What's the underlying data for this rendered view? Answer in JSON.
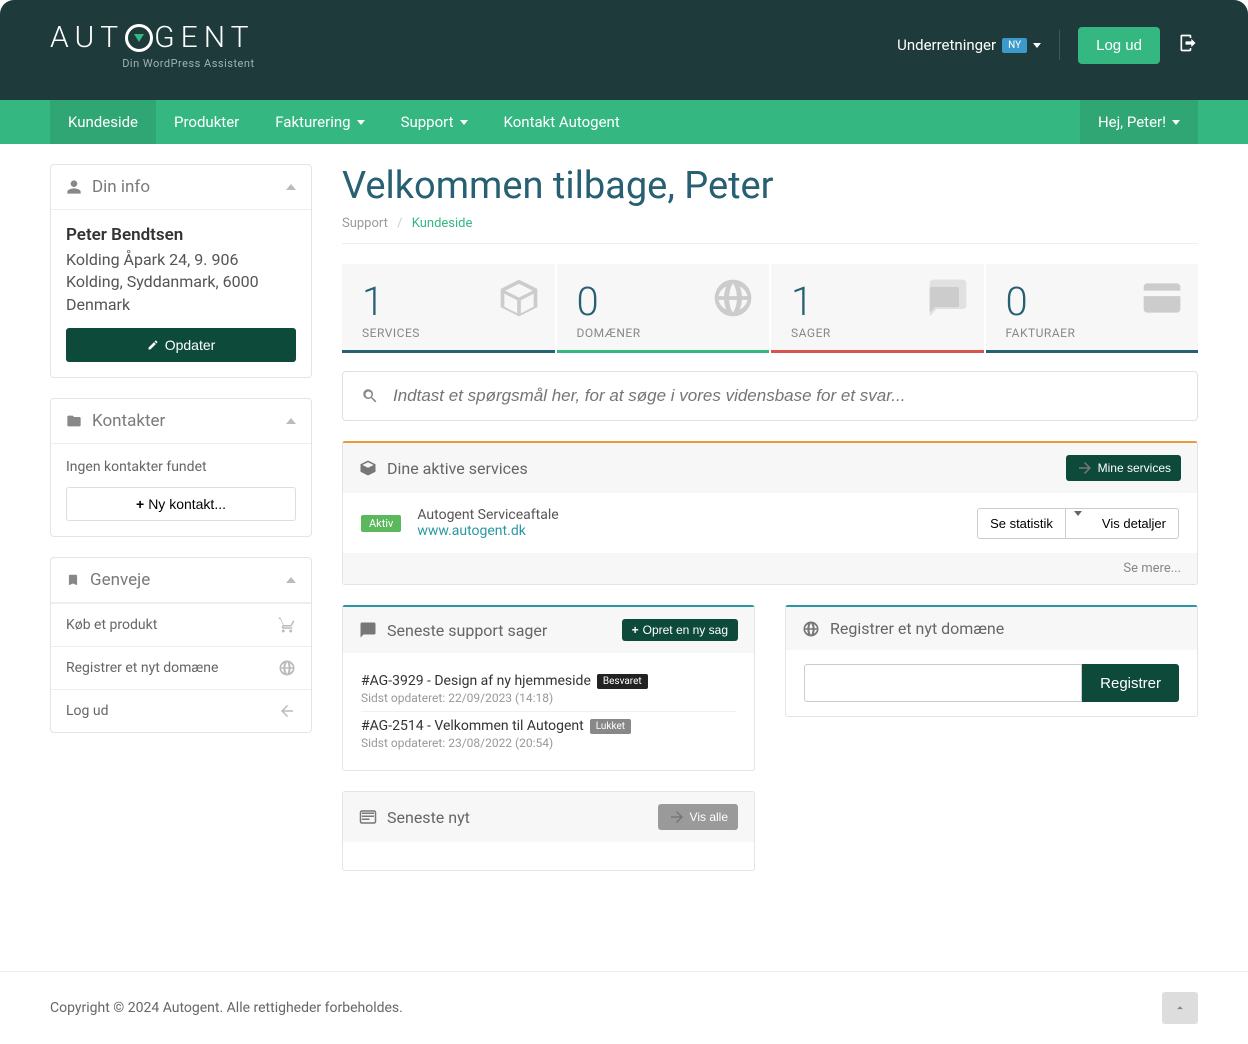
{
  "header": {
    "brand_primary": "AUTOGENT",
    "brand_sub": "Din WordPress Assistent",
    "notifications_label": "Underretninger",
    "notifications_badge": "NY",
    "logout_label": "Log ud"
  },
  "nav": {
    "items": [
      "Kundeside",
      "Produkter",
      "Fakturering",
      "Support",
      "Kontakt Autogent"
    ],
    "greeting": "Hej, Peter!"
  },
  "sidebar": {
    "info_title": "Din info",
    "user_name": "Peter Bendtsen",
    "address_line1": "Kolding Åpark 24, 9. 906",
    "address_line2": "Kolding, Syddanmark, 6000",
    "address_country": "Denmark",
    "update_btn": "Opdater",
    "contacts_title": "Kontakter",
    "no_contacts": "Ingen kontakter fundet",
    "new_contact_btn": "Ny kontakt...",
    "shortcuts_title": "Genveje",
    "shortcuts": [
      "Køb et produkt",
      "Registrer et nyt domæne",
      "Log ud"
    ]
  },
  "main": {
    "welcome": "Velkommen tilbage, Peter",
    "breadcrumb_root": "Support",
    "breadcrumb_current": "Kundeside",
    "stats": [
      {
        "num": "1",
        "label": "SERVICES"
      },
      {
        "num": "0",
        "label": "DOMÆNER"
      },
      {
        "num": "1",
        "label": "SAGER"
      },
      {
        "num": "0",
        "label": "FAKTURAER"
      }
    ],
    "search_placeholder": "Indtast et spørgsmål her, for at søge i vores vidensbase for et svar...",
    "services": {
      "title": "Dine aktive services",
      "btn_all": "Mine services",
      "status": "Aktiv",
      "name": "Autogent Serviceaftale",
      "domain": "www.autogent.dk",
      "btn_stats": "Se statistik",
      "btn_details": "Vis detaljer",
      "more": "Se mere..."
    },
    "tickets": {
      "title": "Seneste support sager",
      "btn_new": "Opret en ny sag",
      "items": [
        {
          "title": "#AG-3929 - Design af ny hjemmeside",
          "status": "Besvaret",
          "status_class": "besvaret",
          "sub": "Sidst opdateret: 22/09/2023 (14:18)"
        },
        {
          "title": "#AG-2514 - Velkommen til Autogent",
          "status": "Lukket",
          "status_class": "lukket",
          "sub": "Sidst opdateret: 23/08/2022 (20:54)"
        }
      ]
    },
    "domain": {
      "title": "Registrer et nyt domæne",
      "btn": "Registrer"
    },
    "news": {
      "title": "Seneste nyt",
      "btn_all": "Vis alle"
    }
  },
  "footer": {
    "copyright": "Copyright © 2024 Autogent. Alle rettigheder forbeholdes."
  }
}
